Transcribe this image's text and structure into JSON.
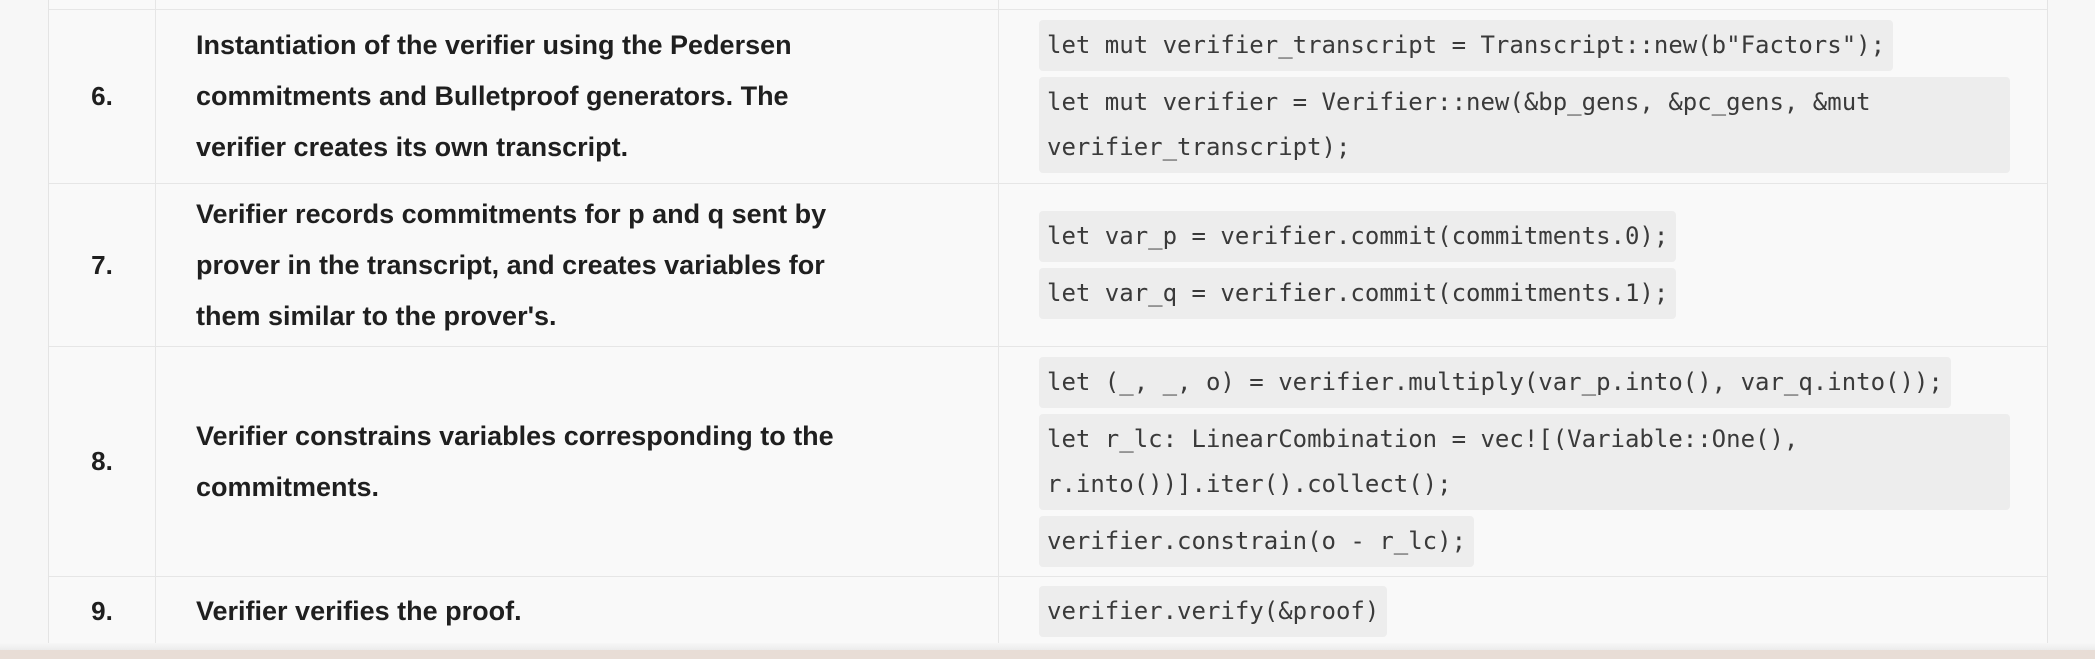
{
  "rows": [
    {
      "number": "6.",
      "description": "Instantiation of the verifier using the Pedersen commitments and Bulletproof generators. The verifier creates its own transcript.",
      "code": [
        "let mut verifier_transcript = Transcript::new(b\"Factors\");",
        "let mut verifier = Verifier::new(&bp_gens, &pc_gens, &mut verifier_transcript);"
      ]
    },
    {
      "number": "7.",
      "description": "Verifier records commitments for p and q sent by prover in the transcript, and creates variables for them similar to the prover's.",
      "code": [
        "let var_p = verifier.commit(commitments.0);",
        "let var_q = verifier.commit(commitments.1);"
      ]
    },
    {
      "number": "8.",
      "description": "Verifier constrains variables corresponding to the commitments.",
      "code": [
        "let (_, _, o) = verifier.multiply(var_p.into(), var_q.into());",
        "let r_lc: LinearCombination = vec![(Variable::One(), r.into())].iter().collect();",
        "verifier.constrain(o - r_lc);"
      ]
    },
    {
      "number": "9.",
      "description": "Verifier verifies the proof.",
      "code": [
        "verifier.verify(&proof)"
      ]
    }
  ]
}
